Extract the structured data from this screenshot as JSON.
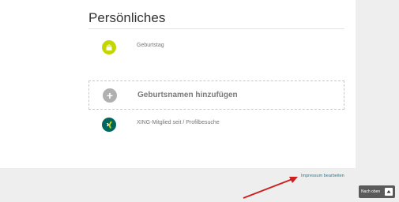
{
  "section": {
    "title": "Persönliches"
  },
  "rows": [
    {
      "label": "Geburtstag",
      "icon": "birthday-cake-icon",
      "color": "#c4d600"
    },
    {
      "label": "XING-Mitglied seit / Profilbesuche",
      "icon": "xing-logo-icon",
      "color": "#00665e"
    }
  ],
  "add_birth_name": {
    "label": "Geburtsnamen hinzufügen",
    "icon": "plus-icon"
  },
  "footer": {
    "impressum_link": "Impressum bearbeiten",
    "back_to_top": "Nach oben",
    "back_to_top_icon": "chevron-up-icon"
  },
  "colors": {
    "accent_link": "#2a7a94",
    "annotation_arrow": "#cc1f1f"
  }
}
